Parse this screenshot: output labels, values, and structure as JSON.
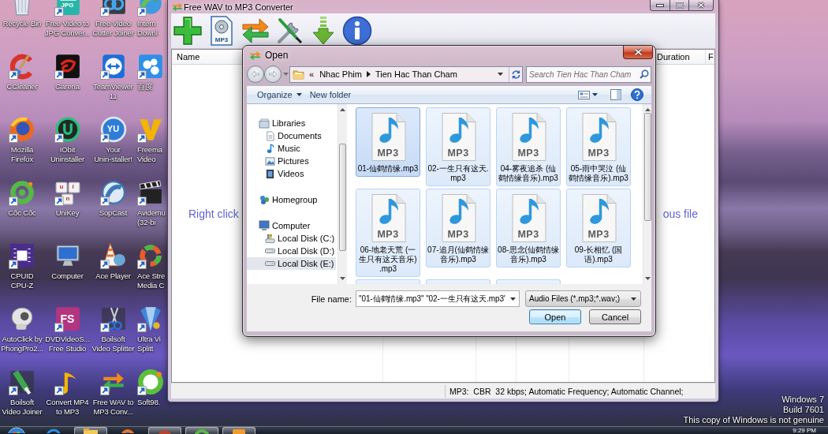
{
  "desktop": {
    "icons": [
      {
        "kind": "recycle",
        "lines": [
          "Recycle Bin"
        ],
        "shortcut": false
      },
      {
        "kind": "jpg",
        "glyphs": [
          "JPG"
        ],
        "lines": [
          "Free Video to",
          "JPG Conver..."
        ],
        "shortcut": true
      },
      {
        "kind": "cutter",
        "lines": [
          "Free Video",
          "Cutter Joiner"
        ],
        "shortcut": true
      },
      {
        "kind": "download",
        "lines": [
          "Intern",
          "Downl"
        ],
        "shortcut": true
      },
      {
        "kind": "cleaner",
        "lines": [
          "CCleaner"
        ],
        "shortcut": true
      },
      {
        "kind": "garena",
        "lines": [
          "Garena"
        ],
        "shortcut": true
      },
      {
        "kind": "teamviewer",
        "lines": [
          "TeamViewer",
          "11"
        ],
        "shortcut": true
      },
      {
        "kind": "cloud",
        "lines": [
          "百度"
        ],
        "shortcut": true
      },
      {
        "kind": "firefox",
        "lines": [
          "Mozilla",
          "Firefox"
        ],
        "shortcut": true
      },
      {
        "kind": "iobit",
        "lines": [
          "IObit",
          "Uninstaller"
        ],
        "shortcut": true
      },
      {
        "kind": "disc",
        "glyphs": [
          "YU"
        ],
        "lines": [
          "Your",
          "Unin-staller!"
        ],
        "shortcut": true
      },
      {
        "kind": "freemake",
        "lines": [
          "Freema",
          "Video"
        ],
        "shortcut": true
      },
      {
        "kind": "coccoc",
        "lines": [
          "Cốc Cốc"
        ],
        "shortcut": true
      },
      {
        "kind": "keys",
        "glyphs": [
          "u",
          "i",
          "n"
        ],
        "lines": [
          "UniKey"
        ],
        "shortcut": true
      },
      {
        "kind": "sopcast",
        "lines": [
          "SopCast"
        ],
        "shortcut": true
      },
      {
        "kind": "clapper",
        "lines": [
          "Avidemu",
          "(32-bi"
        ],
        "shortcut": true
      },
      {
        "kind": "chip",
        "lines": [
          "CPUID",
          "CPU-Z"
        ],
        "shortcut": true
      },
      {
        "kind": "computer",
        "lines": [
          "Computer"
        ],
        "shortcut": false
      },
      {
        "kind": "cone",
        "lines": [
          "Ace Player"
        ],
        "shortcut": true
      },
      {
        "kind": "acestream",
        "lines": [
          "Ace Stre",
          "Media C"
        ],
        "shortcut": true
      },
      {
        "kind": "skull",
        "lines": [
          "AutoClick by",
          "PhongPro2..."
        ],
        "shortcut": false
      },
      {
        "kind": "fs",
        "glyphs": [
          "FS"
        ],
        "lines": [
          "DVDVideoS...",
          "Free Studio"
        ],
        "shortcut": true
      },
      {
        "kind": "scissors",
        "lines": [
          "Boilsoft",
          "Video Splitter"
        ],
        "shortcut": true
      },
      {
        "kind": "ultra",
        "lines": [
          "Ultra Vi",
          "Splitt"
        ],
        "shortcut": true
      },
      {
        "kind": "tube",
        "lines": [
          "Boilsoft",
          "Video Joiner"
        ],
        "shortcut": true
      },
      {
        "kind": "note",
        "lines": [
          "Convert MP4",
          "to MP3"
        ],
        "shortcut": true
      },
      {
        "kind": "arrows",
        "lines": [
          "Free WAV to",
          "MP3 Conv..."
        ],
        "shortcut": true
      },
      {
        "kind": "soft98",
        "lines": [
          "Soft98."
        ],
        "shortcut": true
      }
    ],
    "notice": [
      "Windows 7",
      "Build 7601",
      "This copy of Windows is not genuine"
    ]
  },
  "app_window": {
    "title": "Free WAV to MP3 Converter",
    "toolbar": [
      {
        "kind": "add"
      },
      {
        "kind": "mp3",
        "glyph": "MP3"
      },
      {
        "kind": "convert"
      },
      {
        "kind": "tools"
      },
      {
        "kind": "download"
      },
      {
        "kind": "info"
      }
    ],
    "columns": [
      "Name",
      "Duration",
      "F"
    ],
    "hint": [
      "Right click",
      "ous file"
    ],
    "status": "MP3:  CBR  32 kbps; Automatic Frequency; Automatic Channel;"
  },
  "open_dialog": {
    "title": "Open",
    "address": {
      "overflow": "«",
      "path": [
        "Nhac Phim",
        "Tien Hac Than Cham"
      ]
    },
    "search": {
      "placeholder": "Search Tien Hac Than Cham"
    },
    "commands": [
      {
        "label": "Organize",
        "menu": true
      },
      {
        "label": "New folder",
        "menu": false
      }
    ],
    "nav": [
      {
        "kind": "library",
        "label": "Libraries",
        "selected": false,
        "children": [
          {
            "kind": "documents",
            "label": "Documents",
            "selected": false
          },
          {
            "kind": "music",
            "label": "Music",
            "selected": false
          },
          {
            "kind": "pictures",
            "label": "Pictures",
            "selected": false
          },
          {
            "kind": "videos",
            "label": "Videos",
            "selected": false
          }
        ]
      },
      {
        "kind": "homegroup",
        "label": "Homegroup",
        "selected": false
      },
      {
        "kind": "computer",
        "label": "Computer",
        "selected": false,
        "children": [
          {
            "kind": "system-disk",
            "label": "Local Disk (C:)",
            "selected": false
          },
          {
            "kind": "disk",
            "label": "Local Disk (D:)",
            "selected": false
          },
          {
            "kind": "disk",
            "label": "Local Disk (E:)",
            "selected": true
          }
        ]
      }
    ],
    "files": [
      {
        "lines": [
          "01-仙鹤情缘.mp3"
        ],
        "icon_text": "MP3",
        "selected": true,
        "focused": true
      },
      {
        "lines": [
          "02-一生只有这天.",
          "mp3"
        ],
        "icon_text": "MP3",
        "selected": true,
        "focused": false
      },
      {
        "lines": [
          "04-雾夜追杀 (仙",
          "鹤情缘音乐).mp3"
        ],
        "icon_text": "MP3",
        "selected": true,
        "focused": false
      },
      {
        "lines": [
          "05-雨中哭泣 (仙",
          "鹤情缘音乐).mp3"
        ],
        "icon_text": "MP3",
        "selected": true,
        "focused": false
      },
      {
        "lines": [
          "06-地老天荒 (一",
          "生只有这天音乐)",
          ".mp3"
        ],
        "icon_text": "MP3",
        "selected": true,
        "focused": false
      },
      {
        "lines": [
          "07-追月(仙鹤情缘",
          "音乐).mp3"
        ],
        "icon_text": "MP3",
        "selected": true,
        "focused": false
      },
      {
        "lines": [
          "08-思念(仙鹤情缘",
          "音乐).mp3"
        ],
        "icon_text": "MP3",
        "selected": true,
        "focused": false
      },
      {
        "lines": [
          "09-长相忆 (国",
          "语).mp3"
        ],
        "icon_text": "MP3",
        "selected": true,
        "focused": false
      },
      {
        "selected": true,
        "focused": false
      },
      {
        "selected": true,
        "focused": false
      },
      {
        "selected": true,
        "focused": false
      }
    ],
    "file_name": {
      "label": "File name:",
      "value": "\"01-仙鹤情缘.mp3\" \"02-一生只有这天.mp3\""
    },
    "file_type": "Audio Files (*.mp3;*.wav;)",
    "buttons": [
      {
        "label": "Open",
        "default": true
      },
      {
        "label": "Cancel",
        "default": false
      }
    ]
  },
  "taskbar": {
    "buttons": [
      {
        "kind": "start",
        "open": false
      },
      {
        "kind": "ie",
        "open": false
      },
      {
        "kind": "folder",
        "open": true
      },
      {
        "kind": "firefox",
        "open": false
      },
      {
        "kind": "app",
        "open": true
      },
      {
        "kind": "coccoc",
        "open": true
      },
      {
        "kind": "player",
        "open": true
      }
    ],
    "clock": "9:29 PM"
  }
}
